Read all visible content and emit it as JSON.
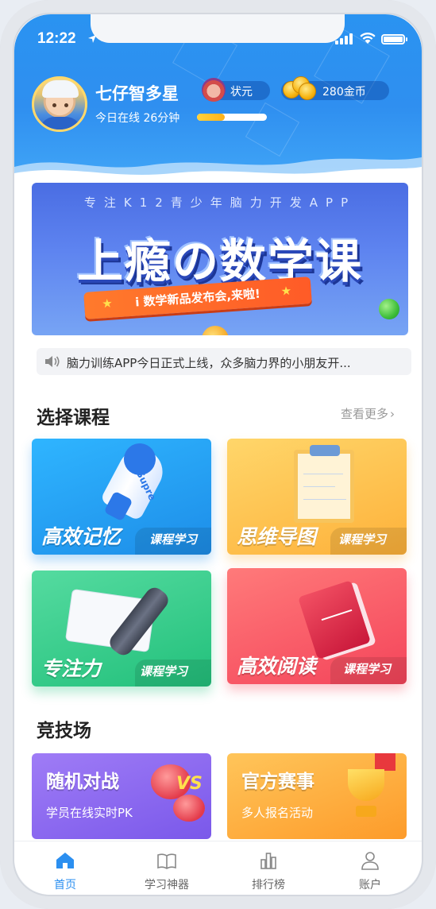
{
  "status_bar": {
    "time": "12:22"
  },
  "user": {
    "name": "七仔智多星",
    "online_text": "今日在线 26分钟",
    "online_progress": 0.4,
    "rank_label": "状元",
    "coins_label": "280金币"
  },
  "banner": {
    "subtitle": "专注K12青少年脑力开发APP",
    "title": "上瘾の数学课",
    "ribbon_text": "i 数学新品发布会,来啦!"
  },
  "notice": {
    "text": "脑力训练APP今日正式上线，众多脑力界的小朋友开..."
  },
  "courses": {
    "title": "选择课程",
    "more_label": "查看更多",
    "items": [
      {
        "name": "高效记忆",
        "tag": "课程学习",
        "color": "#1d8de8",
        "icon": "rocket-icon"
      },
      {
        "name": "思维导图",
        "tag": "课程学习",
        "color": "#fdb13a",
        "icon": "clipboard-icon"
      },
      {
        "name": "专注力",
        "tag": "课程学习",
        "color": "#22c07b",
        "icon": "pen-icon"
      },
      {
        "name": "高效阅读",
        "tag": "课程学习",
        "color": "#f4445a",
        "icon": "book-icon"
      }
    ]
  },
  "arena": {
    "title": "竞技场",
    "items": [
      {
        "title": "随机对战",
        "subtitle": "学员在线实时PK",
        "icon": "boxing-gloves-icon"
      },
      {
        "title": "官方赛事",
        "subtitle": "多人报名活动",
        "icon": "trophy-icon"
      }
    ]
  },
  "tabbar": {
    "items": [
      {
        "label": "首页",
        "icon": "home-icon",
        "active": true
      },
      {
        "label": "学习神器",
        "icon": "book-open-icon",
        "active": false
      },
      {
        "label": "排行榜",
        "icon": "bar-chart-icon",
        "active": false
      },
      {
        "label": "账户",
        "icon": "user-icon",
        "active": false
      }
    ]
  }
}
